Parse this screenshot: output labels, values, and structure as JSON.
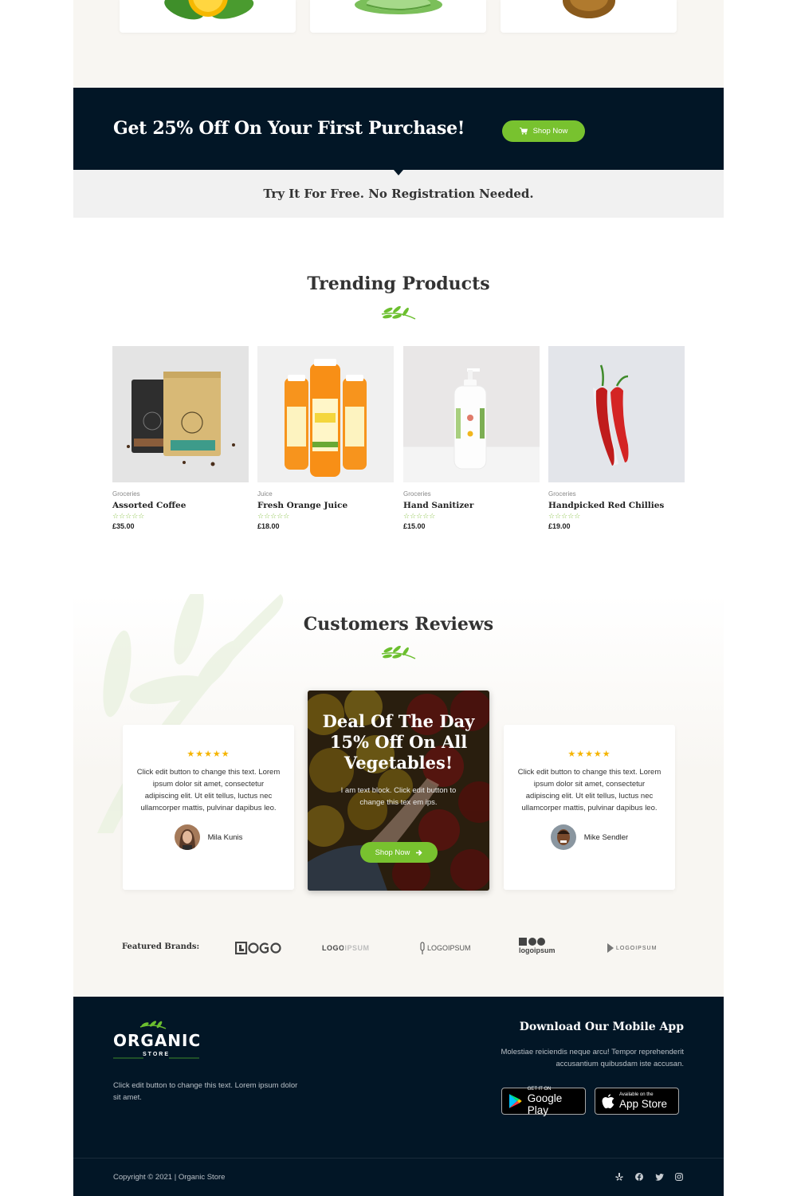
{
  "promo": {
    "title": "Get 25% Off On Your First Purchase!",
    "button_label": "Shop Now",
    "button_icon": "cart-icon",
    "subtitle": "Try It For Free. No Registration Needed."
  },
  "trending": {
    "title": "Trending Products",
    "products": [
      {
        "category": "Groceries",
        "name": "Assorted Coffee",
        "rating": 0,
        "rating_max": 5,
        "price": "£35.00",
        "image": "coffee-bags"
      },
      {
        "category": "Juice",
        "name": "Fresh Orange Juice",
        "rating": 0,
        "rating_max": 5,
        "price": "£18.00",
        "image": "orange-juice-bottles"
      },
      {
        "category": "Groceries",
        "name": "Hand Sanitizer",
        "rating": 0,
        "rating_max": 5,
        "price": "£15.00",
        "image": "sanitizer-bottle"
      },
      {
        "category": "Groceries",
        "name": "Handpicked Red Chillies",
        "rating": 0,
        "rating_max": 5,
        "price": "£19.00",
        "image": "red-chillies"
      }
    ],
    "empty_stars": "☆☆☆☆☆"
  },
  "reviews": {
    "title": "Customers Reviews",
    "items": [
      {
        "stars": "★★★★★",
        "rating": 5,
        "text": "Click edit button to change this text. Lorem ipsum dolor sit amet, consectetur adipiscing elit. Ut elit tellus, luctus nec ullamcorper mattis, pulvinar dapibus leo.",
        "author": "Mila Kunis"
      },
      {
        "stars": "★★★★★",
        "rating": 5,
        "text": "Click edit button to change this text. Lorem ipsum dolor sit amet, consectetur adipiscing elit. Ut elit tellus, luctus nec ullamcorper mattis, pulvinar dapibus leo.",
        "author": "Mike Sendler"
      }
    ],
    "deal": {
      "title_line1": "Deal Of The Day",
      "title_line2": "15% Off On All",
      "title_line3": "Vegetables!",
      "text": "I am text block. Click edit button to change this tex em ips.",
      "button_label": "Shop Now",
      "button_icon": "arrow-right-icon"
    }
  },
  "brands": {
    "label": "Featured Brands:",
    "logos": [
      "LOGO",
      "LOGOIPSUM",
      "LOGOIPSUM",
      "logoipsum",
      "LOGOIPSUM"
    ]
  },
  "footer": {
    "logo_main": "ORGANIC",
    "logo_sub": "STORE",
    "about_text": "Click edit button to change this text. Lorem ipsum dolor sit amet.",
    "app_title": "Download Our Mobile App",
    "app_text": "Molestiae reiciendis neque arcu! Tempor reprehenderit accusantium quibusdam iste accusan.",
    "google_play": {
      "small": "GET IT ON",
      "big": "Google Play"
    },
    "app_store": {
      "small": "Available on the",
      "big": "App Store"
    },
    "copyright": "Copyright © 2021 | Organic Store",
    "social": [
      "yelp-icon",
      "facebook-icon",
      "twitter-icon",
      "instagram-icon"
    ]
  },
  "colors": {
    "accent_green": "#78c22f",
    "dark_navy": "#021626",
    "star_gold": "#f5b400",
    "cream_bg": "#f8f6f2"
  }
}
